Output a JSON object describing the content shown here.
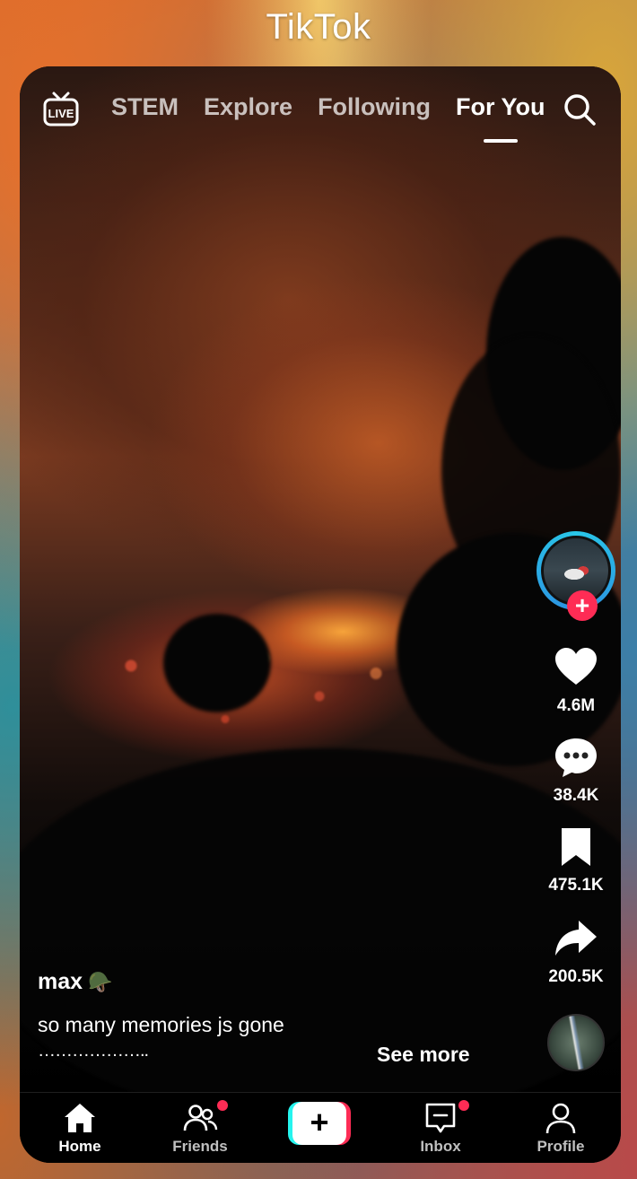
{
  "app": {
    "title": "TikTok"
  },
  "top_nav": {
    "live_label": "LIVE",
    "tabs": [
      {
        "label": "STEM",
        "active": false
      },
      {
        "label": "Explore",
        "active": false
      },
      {
        "label": "Following",
        "active": false
      },
      {
        "label": "For You",
        "active": true
      }
    ],
    "search_icon": "search-icon"
  },
  "rail": {
    "follow_label": "+",
    "likes": "4.6M",
    "comments": "38.4K",
    "saves": "475.1K",
    "shares": "200.5K"
  },
  "post": {
    "username": "max",
    "username_emoji": "🪖",
    "description": "so many memories js gone",
    "dots": "………………..",
    "see_more": "See more"
  },
  "bottom_nav": {
    "home": "Home",
    "friends": "Friends",
    "create": "+",
    "inbox": "Inbox",
    "profile": "Profile"
  },
  "colors": {
    "accent_pink": "#fe2c55",
    "accent_cyan": "#25f4ee",
    "avatar_ring": "#29c7e8"
  }
}
